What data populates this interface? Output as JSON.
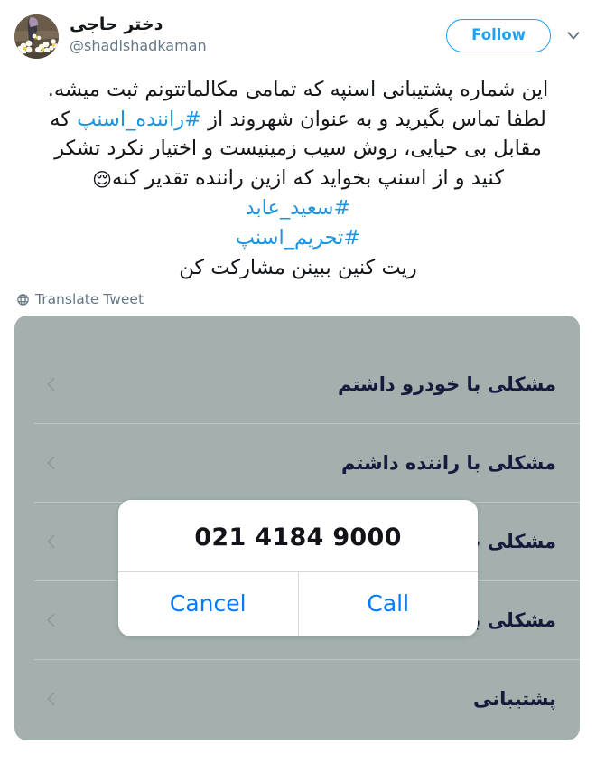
{
  "tweet": {
    "display_name": "دختر حاجی",
    "handle": "@shadishadkaman",
    "follow_label": "Follow",
    "caret_icon": "chevron-down-icon",
    "avatar_icon": "avatar-flowers",
    "body_lines": [
      {
        "id": "l1",
        "segments": [
          {
            "text": "این شماره پشتیبانی اسنپه که تمامی مکالماتتونم ثبت میشه.",
            "type": "text"
          }
        ]
      },
      {
        "id": "l2",
        "segments": [
          {
            "text": "لطفا تماس بگیرید و به عنوان شهروند از ",
            "type": "text"
          },
          {
            "text": "#راننده_اسنپ",
            "type": "hashtag"
          },
          {
            "text": " که",
            "type": "text"
          }
        ]
      },
      {
        "id": "l3",
        "segments": [
          {
            "text": "مقابل بی حیایی، روش سیب زمینیست و اختیار نکرد تشکر",
            "type": "text"
          }
        ]
      },
      {
        "id": "l4",
        "segments": [
          {
            "text": "کنید و از اسنپ بخواید که ازین راننده تقدیر کنه",
            "type": "text"
          },
          {
            "text": "😌",
            "type": "emoji"
          }
        ]
      },
      {
        "id": "l5",
        "segments": [
          {
            "text": "#سعید_عابد",
            "type": "hashtag"
          }
        ]
      },
      {
        "id": "l6",
        "segments": [
          {
            "text": "#تحریم_اسنپ",
            "type": "hashtag"
          }
        ]
      },
      {
        "id": "l7",
        "segments": [
          {
            "text": "ریت کنین ببینن مشارکت کن",
            "type": "text"
          }
        ]
      }
    ],
    "translate_label": "Translate Tweet",
    "translate_icon": "globe-icon"
  },
  "screenshot": {
    "rows": [
      {
        "label": "مشکلی با خودرو داشتم",
        "chevron_icon": "chevron-left-icon"
      },
      {
        "label": "مشکلی با راننده داشتم",
        "chevron_icon": "chevron-left-icon"
      },
      {
        "label": "مشکلی ب",
        "chevron_icon": "chevron-left-icon"
      },
      {
        "label": "مشکلی با اپلیکیشن دارم",
        "chevron_icon": "chevron-left-icon"
      },
      {
        "label": "پشتیبانی",
        "chevron_icon": "chevron-left-icon"
      }
    ],
    "background_color": "#a3b0ae",
    "label_color": "#141b3d"
  },
  "call_dialog": {
    "phone_number": "021 4184 9000",
    "cancel_label": "Cancel",
    "call_label": "Call",
    "accent_color": "#007aff"
  },
  "colors": {
    "twitter_blue": "#1da1f2",
    "link_blue": "#1b95e0",
    "muted_gray": "#657786"
  }
}
